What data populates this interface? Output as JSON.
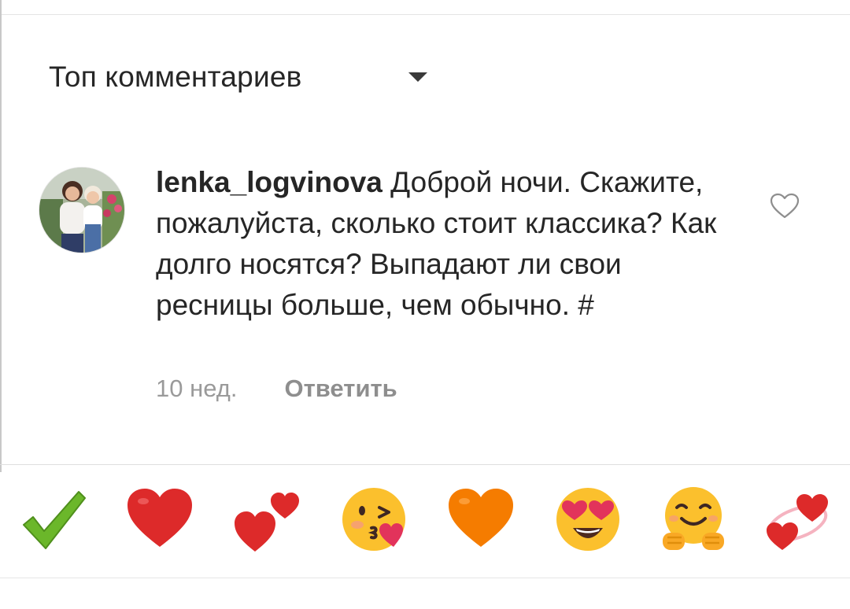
{
  "header": {
    "sort_label": "Топ комментариев",
    "sort_icon": "caret-down-icon"
  },
  "comment": {
    "username": "lenka_logvinova",
    "text": "Доброй ночи. Скажите, пожалуйста, сколько стоит классика? Как долго носятся? Выпадают ли свои ресницы больше, чем обычно. #",
    "time": "10 нед.",
    "reply_label": "Ответить",
    "like_icon": "heart-outline-icon"
  },
  "emoji_bar": {
    "items": [
      {
        "name": "check-mark-icon"
      },
      {
        "name": "red-heart-icon"
      },
      {
        "name": "heart-exclamation-icon"
      },
      {
        "name": "face-blowing-kiss-icon"
      },
      {
        "name": "orange-heart-icon"
      },
      {
        "name": "heart-eyes-face-icon"
      },
      {
        "name": "hugging-face-icon"
      },
      {
        "name": "revolving-hearts-icon"
      }
    ]
  },
  "colors": {
    "text": "#262626",
    "muted": "#9a9a9a",
    "divider": "#dedede",
    "heart_red": "#dd2a2a",
    "heart_orange": "#f57c00",
    "check_green": "#6bb72a",
    "emoji_yellow": "#fbc02d"
  }
}
